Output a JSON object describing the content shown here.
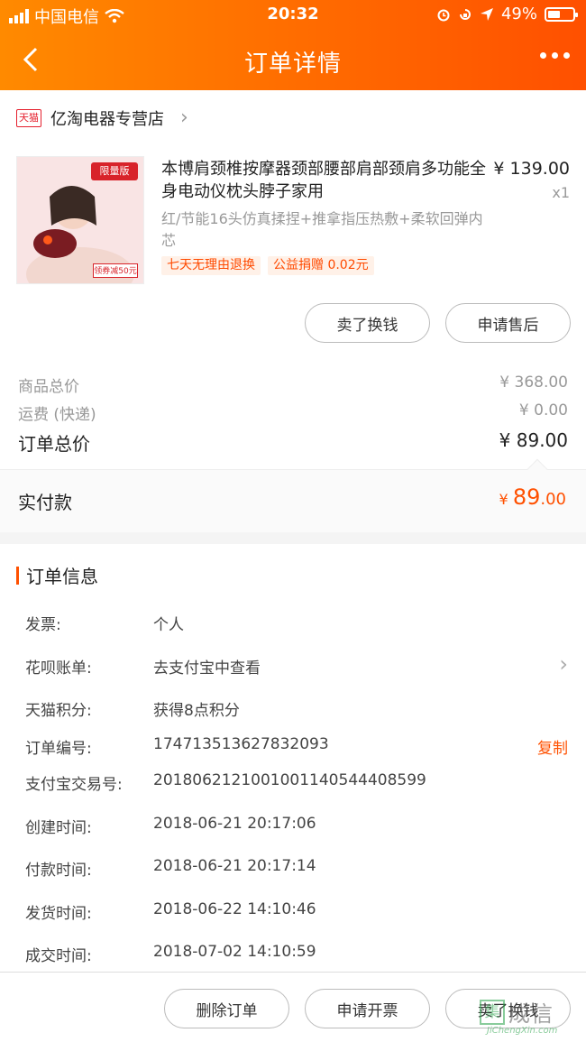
{
  "status": {
    "carrier": "中国电信",
    "time": "20:32",
    "battery": "49%",
    "battery_level": 0.49
  },
  "nav": {
    "title": "订单详情"
  },
  "store": {
    "badge": "天猫",
    "name": "亿淘电器专营店"
  },
  "product": {
    "title": "本博肩颈椎按摩器颈部腰部肩部颈肩多功能全身电动仪枕头脖子家用",
    "price": "¥ 139.00",
    "qty": "x1",
    "sku": "红/节能16头仿真揉捏+推拿指压热敷+柔软回弹内芯",
    "thumb_tag": "限量版",
    "thumb_tag2": "领券减50元",
    "chips": [
      "七天无理由退换",
      "公益捐赠 0.02元"
    ]
  },
  "item_actions": {
    "sell": "卖了换钱",
    "after_sale": "申请售后"
  },
  "totals": {
    "goods_label": "商品总价",
    "goods_value": "¥ 368.00",
    "ship_label": "运费 (快递)",
    "ship_value": "¥ 0.00",
    "order_label": "订单总价",
    "order_value": "¥ 89.00"
  },
  "paid": {
    "label": "实付款",
    "currency": "¥",
    "integer": "89",
    "decimal": ".00"
  },
  "info": {
    "title": "订单信息",
    "rows": [
      {
        "k": "发票:",
        "v": "个人"
      },
      {
        "k": "花呗账单:",
        "v": "去支付宝中查看"
      },
      {
        "k": "天猫积分:",
        "v": "获得8点积分"
      },
      {
        "k": "订单编号:",
        "v": "174713513627832093",
        "action": "复制"
      },
      {
        "k": "支付宝交易号:",
        "v": "2018062121001001140544408599"
      },
      {
        "k": "创建时间:",
        "v": "2018-06-21 20:17:06"
      },
      {
        "k": "付款时间:",
        "v": "2018-06-21 20:17:14"
      },
      {
        "k": "发货时间:",
        "v": "2018-06-22 14:10:46"
      },
      {
        "k": "成交时间:",
        "v": "2018-07-02 14:10:59"
      }
    ]
  },
  "bottom": {
    "delete": "删除订单",
    "invoice": "申请开票",
    "sell": "卖了换钱"
  },
  "watermark": {
    "box": "集",
    "text": "成信",
    "url": "JiChengXin.com"
  },
  "colors": {
    "accent": "#ff5000",
    "header_start": "#ff8a00",
    "tmall_red": "#e5202e"
  }
}
